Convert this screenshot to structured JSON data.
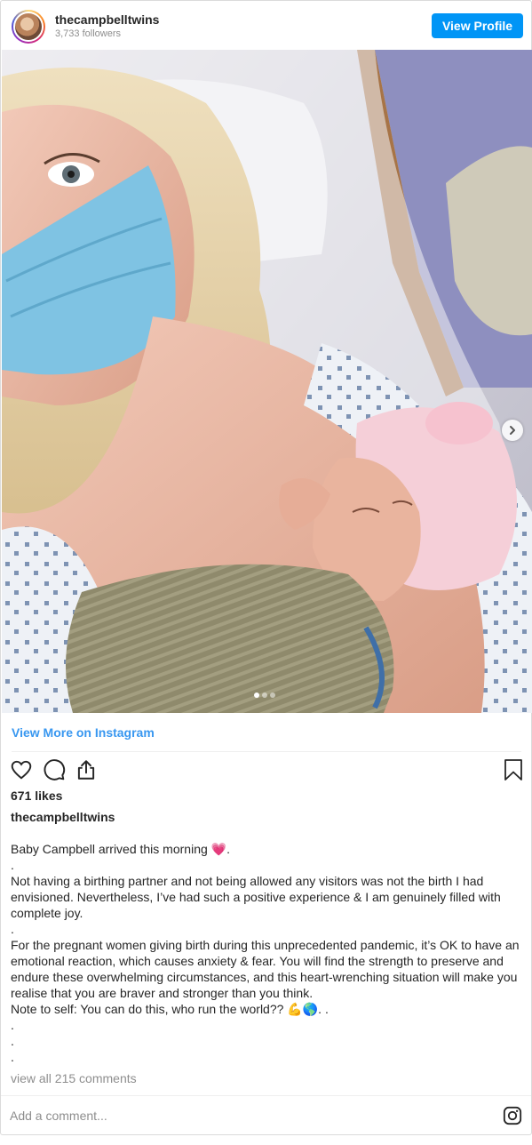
{
  "header": {
    "username": "thecampbelltwins",
    "followers": "3,733 followers",
    "view_profile_label": "View Profile"
  },
  "post": {
    "image_alt": "Selfie of a mother wearing a blue face mask in a hospital bed holding a newborn in a pink bow headband",
    "carousel": {
      "count": 3,
      "active": 1
    },
    "view_more_label": "View More on Instagram",
    "likes": "671 likes",
    "caption_username": "thecampbelltwins",
    "caption_lines": [
      "Baby Campbell arrived this morning 💗.",
      ".",
      "Not having a birthing partner and not being allowed any visitors was not the birth I had envisioned. Nevertheless, I’ve had such a positive experience & I am genuinely filled with complete joy.",
      ".",
      "For the pregnant women giving birth during this unprecedented pandemic, it’s OK to have an emotional reaction, which causes anxiety & fear. You will find the strength to preserve and endure these overwhelming circumstances, and this heart-wrenching situation will make you realise that you are braver and stronger than you think.",
      "Note to self: You can do this, who run the world?? 💪🌎. .",
      ".",
      ".",
      "."
    ],
    "view_comments": "view all 215 comments",
    "comment_placeholder": "Add a comment..."
  },
  "icons": {
    "like": "heart-icon",
    "comment": "comment-icon",
    "share": "share-icon",
    "save": "bookmark-icon",
    "next": "chevron-right-icon",
    "brand": "instagram-icon"
  },
  "colors": {
    "accent": "#0095f6",
    "link": "#3897f0",
    "muted": "#8e8e8e",
    "text": "#262626"
  }
}
